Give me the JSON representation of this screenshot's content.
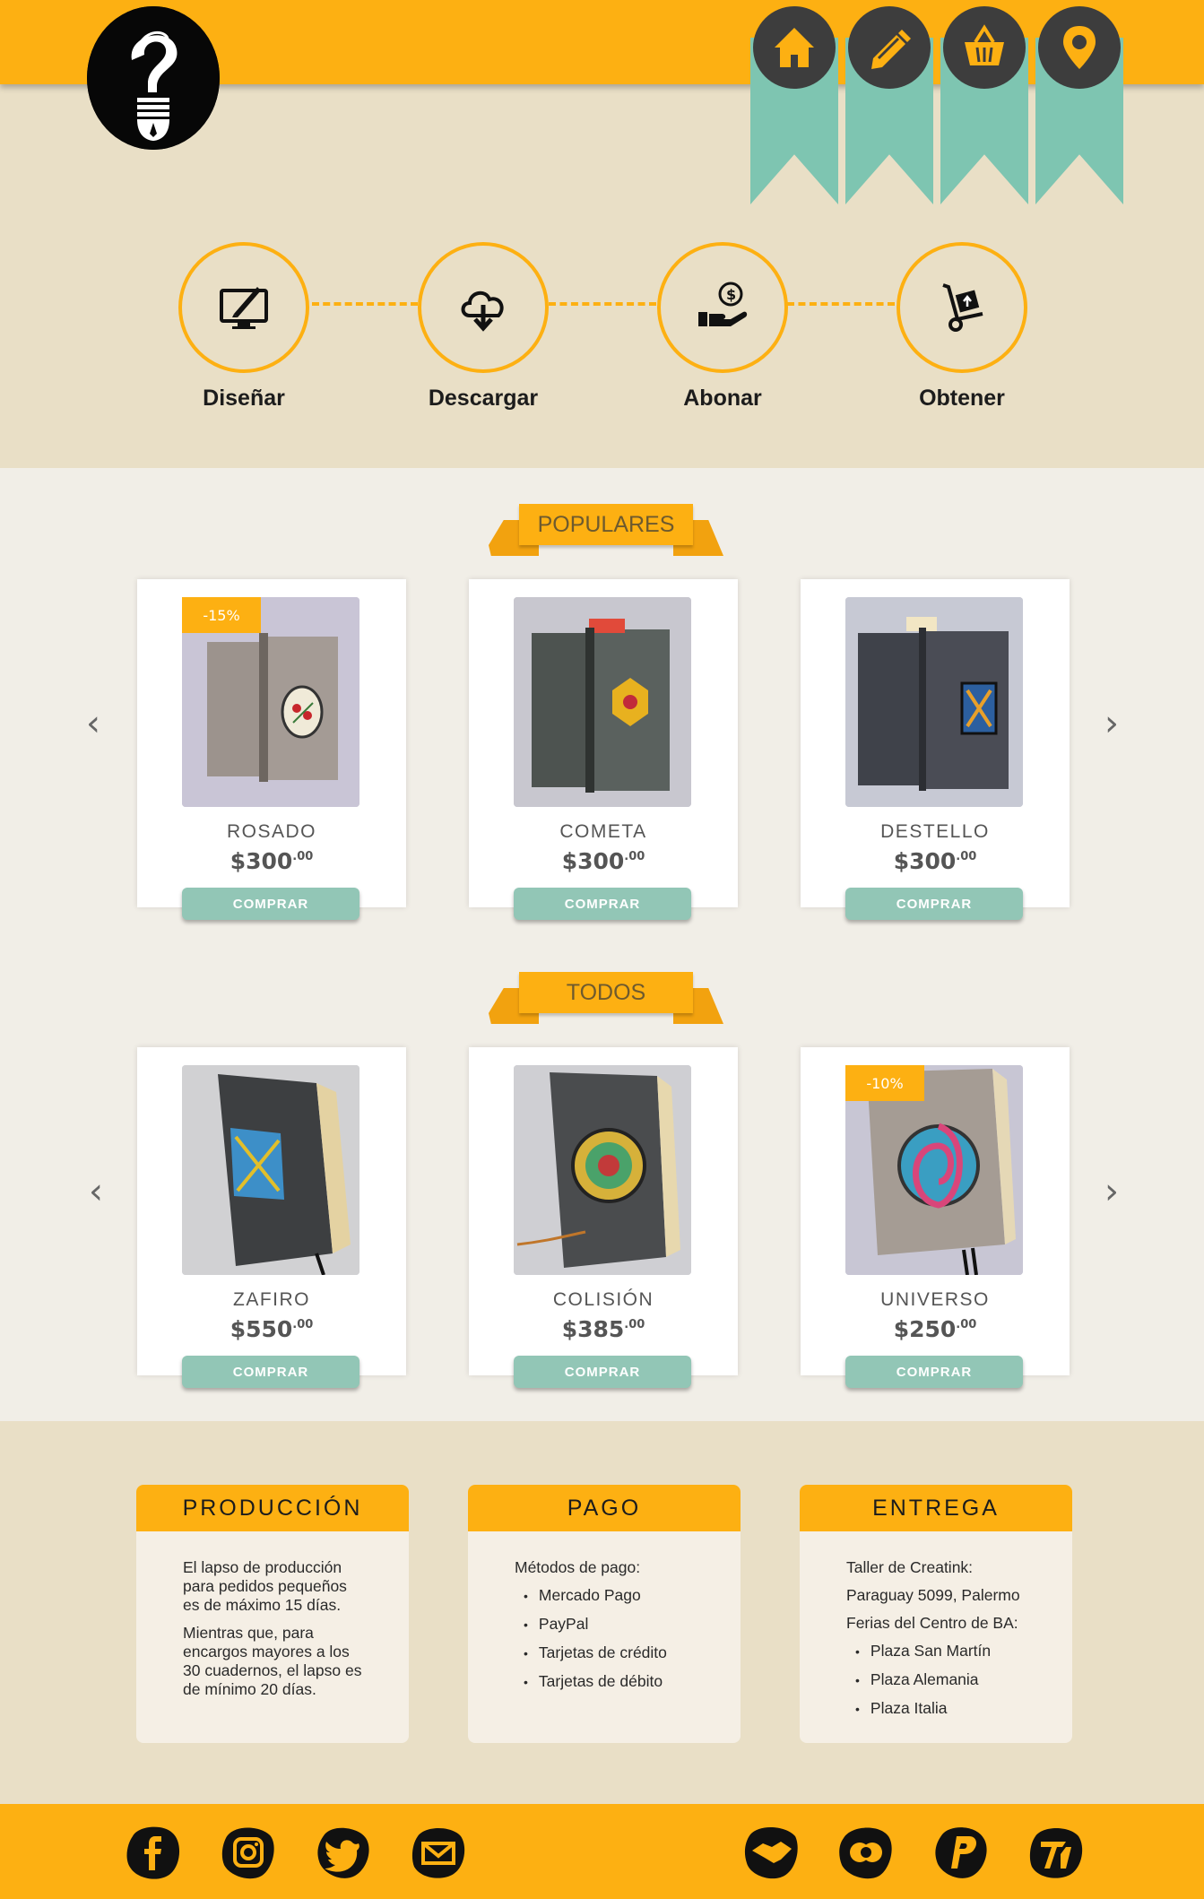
{
  "header": {
    "nav": [
      {
        "name": "home-icon"
      },
      {
        "name": "pencil-icon"
      },
      {
        "name": "basket-icon"
      },
      {
        "name": "location-pin-icon"
      }
    ]
  },
  "steps": [
    {
      "label": "Diseñar",
      "icon": "monitor-design-icon"
    },
    {
      "label": "Descargar",
      "icon": "cloud-download-icon"
    },
    {
      "label": "Abonar",
      "icon": "hand-money-icon"
    },
    {
      "label": "Obtener",
      "icon": "hand-truck-icon"
    }
  ],
  "popular": {
    "title": "POPULARES",
    "products": [
      {
        "name": "ROSADO",
        "price": "$300",
        "cents": ".00",
        "badge": "-15%",
        "cover": "#a49b95",
        "art": "#f0ead8",
        "button": "COMPRAR"
      },
      {
        "name": "COMETA",
        "price": "$300",
        "cents": ".00",
        "badge": "",
        "cover": "#5a615e",
        "art": "#e8b11f",
        "button": "COMPRAR"
      },
      {
        "name": "DESTELLO",
        "price": "$300",
        "cents": ".00",
        "badge": "",
        "cover": "#4a4c55",
        "art": "#2c5f9f",
        "button": "COMPRAR"
      }
    ]
  },
  "all": {
    "title": "TODOS",
    "products": [
      {
        "name": "ZAFIRO",
        "price": "$550",
        "cents": ".00",
        "badge": "",
        "cover": "#3d3f41",
        "art": "#3d8fc8",
        "button": "COMPRAR"
      },
      {
        "name": "COLISIÓN",
        "price": "$385",
        "cents": ".00",
        "badge": "",
        "cover": "#4a4c4e",
        "art": "#d6b13a",
        "button": "COMPRAR"
      },
      {
        "name": "UNIVERSO",
        "price": "$250",
        "cents": ".00",
        "badge": "-10%",
        "cover": "#a59c94",
        "art": "#3a9ec2",
        "button": "COMPRAR"
      }
    ]
  },
  "info": {
    "production": {
      "title": "PRODUCCIÓN",
      "p1": "El lapso de producción para pedidos pequeños es de máximo 15 días.",
      "p2": "Mientras que, para encargos mayores a los 30 cuadernos, el lapso es de mínimo 20 días."
    },
    "payment": {
      "title": "PAGO",
      "intro": "Métodos de pago:",
      "items": [
        "Mercado Pago",
        "PayPal",
        "Tarjetas de crédito",
        "Tarjetas de débito"
      ]
    },
    "delivery": {
      "title": "ENTREGA",
      "line1": "Taller de Creatink:",
      "line2": "Paraguay 5099, Palermo",
      "line3": "Ferias del Centro de BA:",
      "items": [
        "Plaza San Martín",
        "Plaza Alemania",
        "Plaza Italia"
      ]
    }
  },
  "footer": {
    "social": [
      "facebook-icon",
      "instagram-icon",
      "twitter-icon",
      "mail-icon"
    ],
    "payments": [
      "handshake-icon",
      "mastercard-icon",
      "paypal-icon",
      "todopago-icon"
    ]
  },
  "colors": {
    "accent": "#fdb012",
    "teal": "#7ec5b1",
    "background": "#e9dfc6",
    "dark": "#3d3d3d"
  }
}
